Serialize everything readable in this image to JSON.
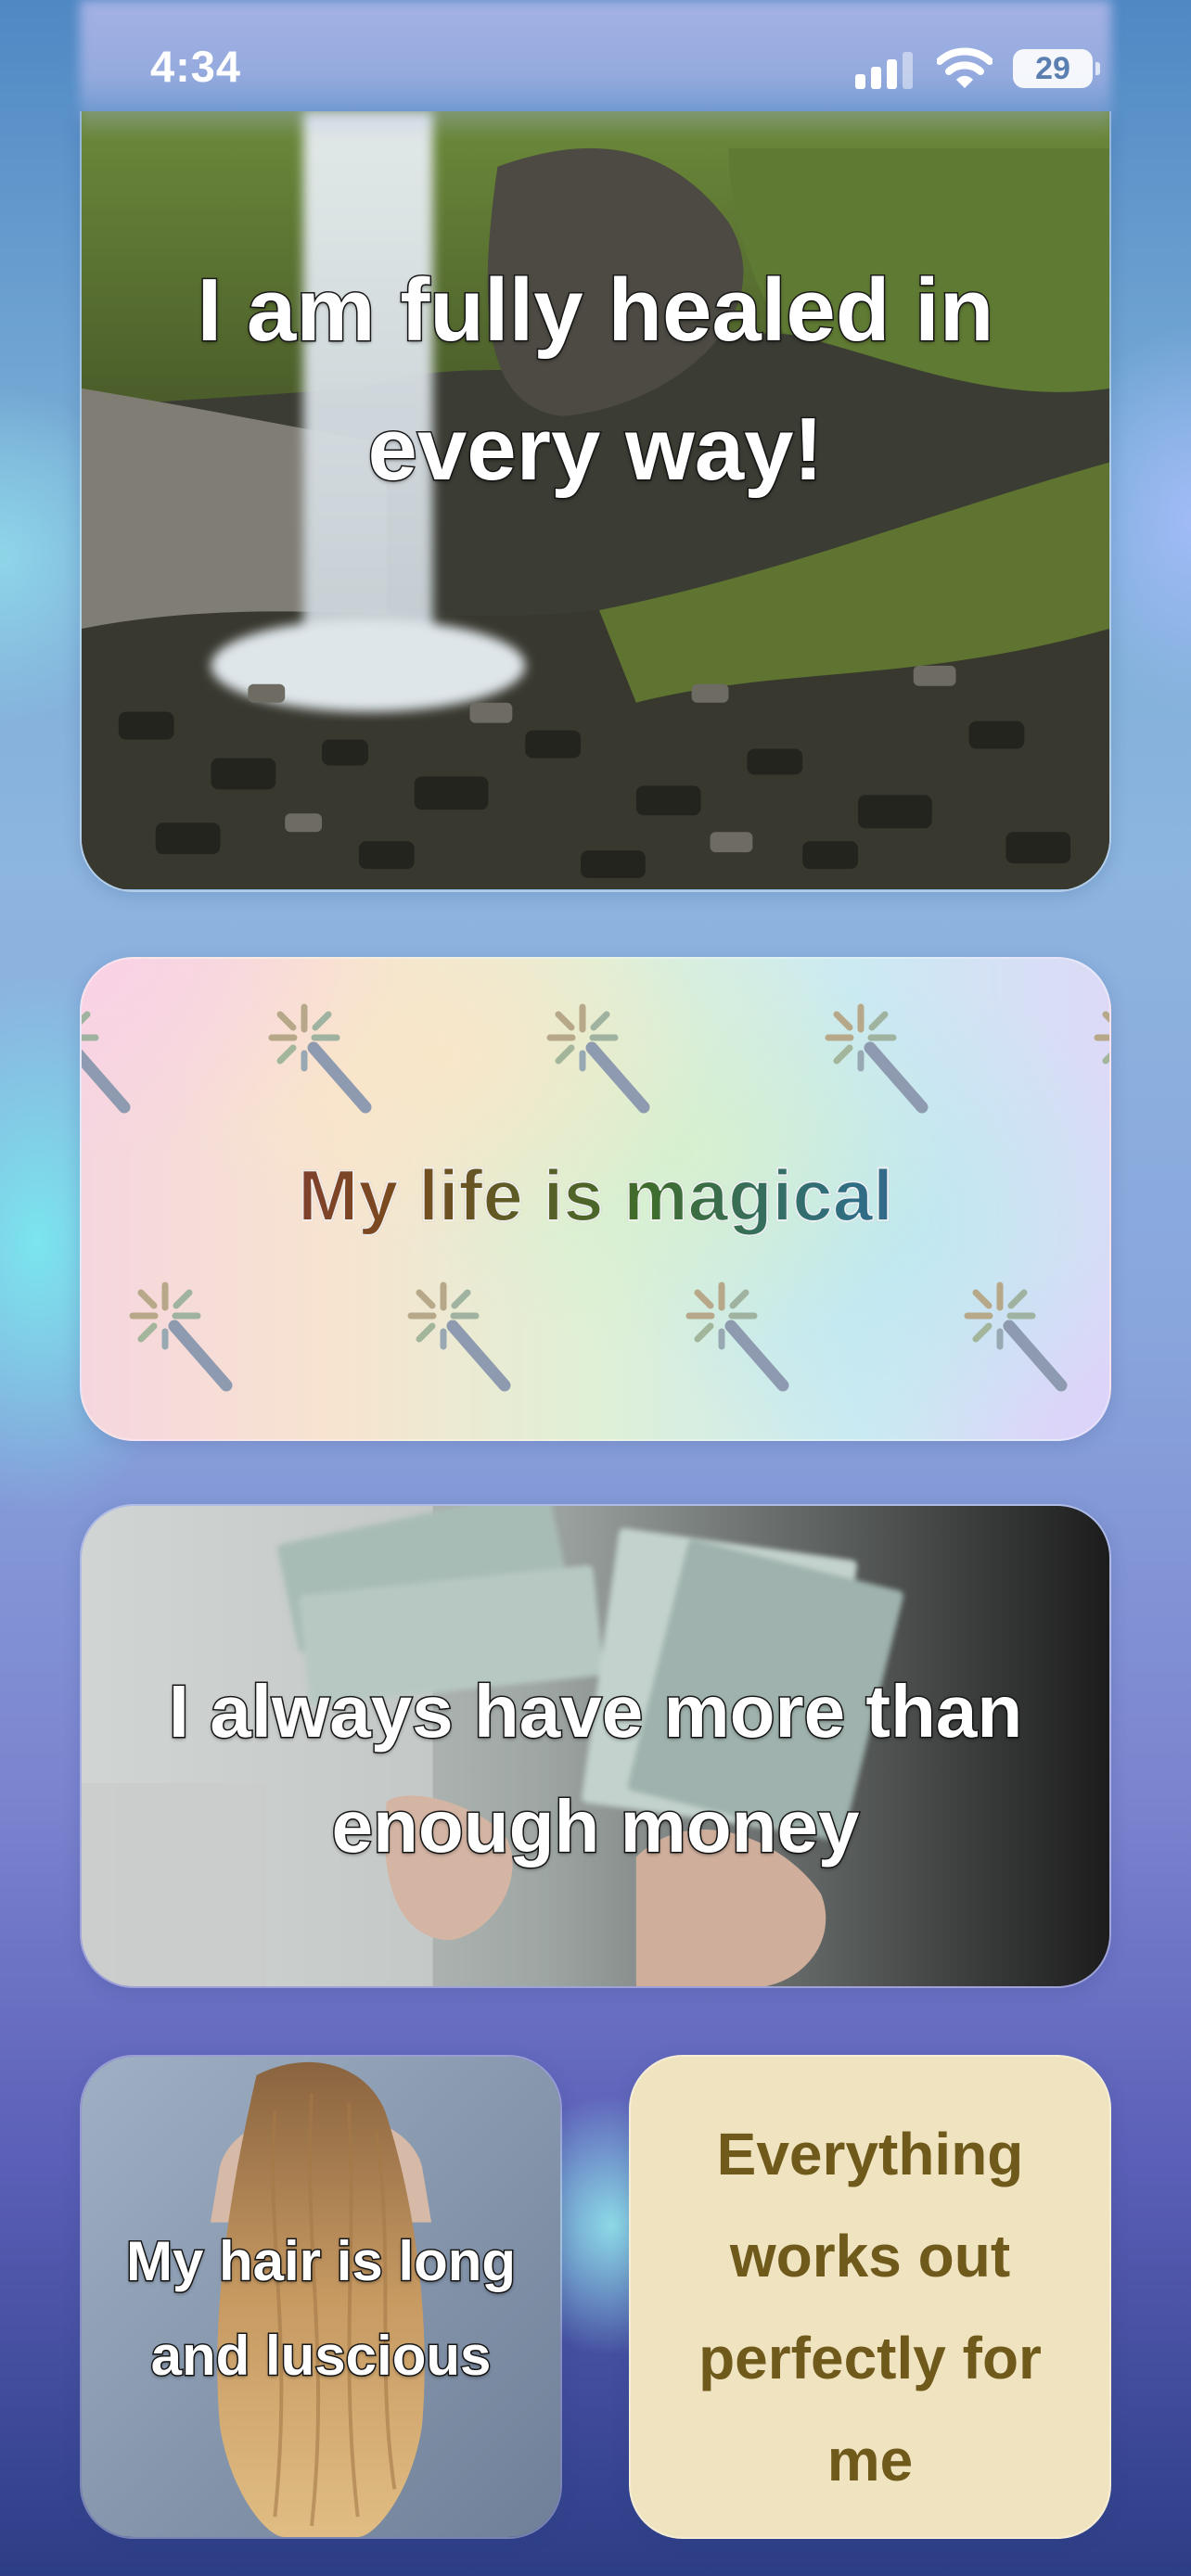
{
  "status_bar": {
    "time": "4:34",
    "battery_level": "29",
    "icons": [
      "signal-icon",
      "wifi-icon",
      "battery-icon"
    ]
  },
  "widgets": [
    {
      "type": "photo",
      "scene": "waterfall",
      "text": "I am fully healed in every way!"
    },
    {
      "type": "gradient",
      "decoration": "magic-wand-icon",
      "text": "My life is magical"
    },
    {
      "type": "photo",
      "scene": "money",
      "text": "I always have more than enough money"
    },
    {
      "type": "photo",
      "scene": "long-hair",
      "text": "My hair is long and luscious"
    },
    {
      "type": "solid",
      "text": "Everything works out perfectly for me",
      "background": "#f0e4c0",
      "text_color": "#6f5a1c"
    }
  ]
}
